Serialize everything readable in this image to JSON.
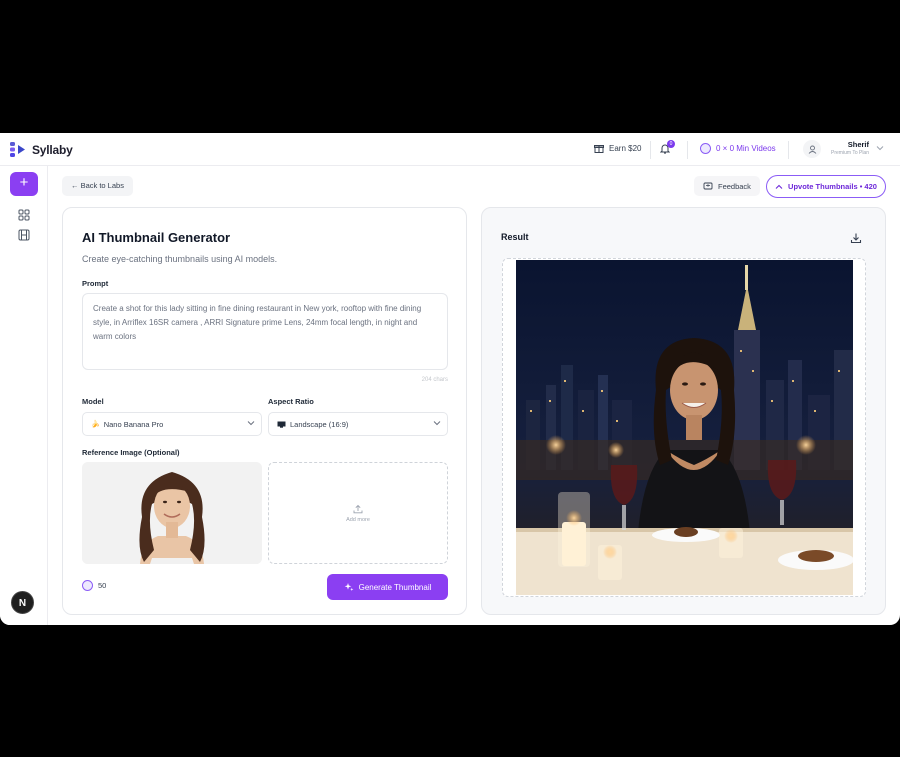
{
  "app": {
    "name": "Syllaby"
  },
  "topbar": {
    "earn": "Earn $20",
    "notifications_count": "0",
    "videos": "0 × 0 Min Videos",
    "user_name": "Sherif",
    "user_plan": "Premium To Plan"
  },
  "subheader": {
    "back": "← Back to Labs",
    "feedback": "Feedback",
    "upvote": "Upvote Thumbnails • 420"
  },
  "generator": {
    "title": "AI Thumbnail Generator",
    "subtitle": "Create eye-catching thumbnails using AI models.",
    "prompt_label": "Prompt",
    "prompt_value": "Create a shot for this lady sitting in fine dining restaurant in New york, rooftop with fine dining style, in Arriflex 16SR camera , ARRI Signature prime Lens, 24mm focal length, in night and warm colors",
    "char_count": "204 chars",
    "model_label": "Model",
    "model_value": "Nano Banana Pro",
    "aspect_label": "Aspect Ratio",
    "aspect_value": "Landscape (16:9)",
    "reference_label": "Reference Image (Optional)",
    "add_more": "Add more",
    "credits": "50",
    "generate": "Generate Thumbnail"
  },
  "result": {
    "title": "Result"
  },
  "rail": {
    "avatar_letter": "N"
  },
  "colors": {
    "accent": "#8b3ff2",
    "accent_border": "#8b5cf6",
    "accent_text": "#6d28d9"
  },
  "icons": [
    "plus-icon",
    "grid-icon",
    "film-icon",
    "gift-icon",
    "bell-icon",
    "coin-icon",
    "user-icon",
    "chevron-down-icon",
    "arrow-up-icon",
    "message-icon",
    "upload-icon",
    "sparkle-icon",
    "download-icon"
  ]
}
